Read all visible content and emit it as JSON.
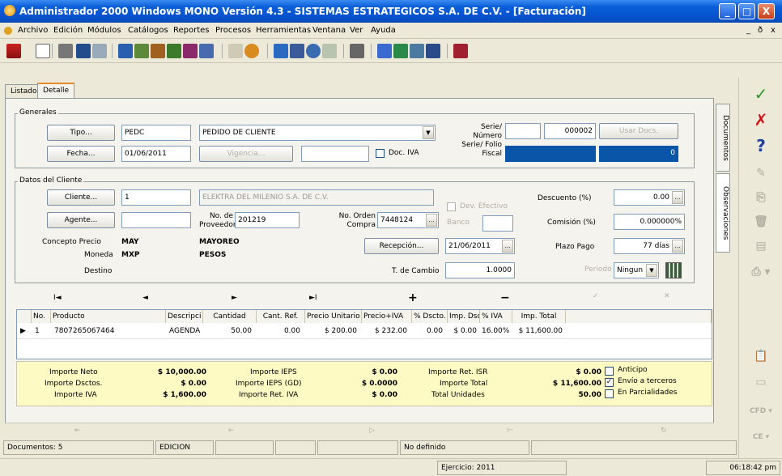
{
  "window": {
    "title": "Administrador 2000 Windows MONO Versión 4.3 - SISTEMAS ESTRATEGICOS S.A. DE C.V. - [Facturación]",
    "min": "_",
    "max": "□",
    "close": "X"
  },
  "menu": [
    "Archivo",
    "Edición",
    "Módulos",
    "Catálogos",
    "Reportes",
    "Procesos",
    "Herramientas",
    "Ventana",
    "Ver",
    "Ayuda"
  ],
  "mdi_controls": [
    "_",
    "ð",
    "x"
  ],
  "tabs": {
    "listado": "Listado",
    "detalle": "Detalle"
  },
  "generales": {
    "section": "Generales",
    "tipo_btn": "Tipo...",
    "tipo_code": "PEDC",
    "tipo_desc": "PEDIDO DE CLIENTE",
    "fecha_btn": "Fecha...",
    "fecha": "01/06/2011",
    "vigencia_btn": "Vigencia...",
    "doc_iva": "Doc. IVA",
    "serie_numero_label": "Serie/\nNúmero",
    "serie": "",
    "numero": "000002",
    "usar_docs": "Usar Docs.",
    "serie_folio_label": "Serie/ Folio\nFiscal",
    "folio_fiscal": "0"
  },
  "cliente": {
    "section": "Datos del Cliente",
    "cliente_btn": "Cliente...",
    "cliente_code": "1",
    "cliente_nombre": "ELEKTRA DEL MILENIO S.A. DE C.V.",
    "agente_btn": "Agente...",
    "no_proveedor_label": "No. de\nProveedor",
    "no_proveedor": "201219",
    "no_orden_label": "No. Orden\nCompra",
    "no_orden": "7448124",
    "dev_efectivo": "Dev. Efectivo",
    "banco": "Banco",
    "recepcion_btn": "Recepción...",
    "recepcion_fecha": "21/06/2011",
    "t_cambio_label": "T. de Cambio",
    "t_cambio": "1.0000",
    "concepto_precio_label": "Concepto Precio",
    "concepto_precio": "MAY",
    "concepto_precio_desc": "MAYOREO",
    "moneda_label": "Moneda",
    "moneda": "MXP",
    "moneda_desc": "PESOS",
    "destino_label": "Destino",
    "descuento_label": "Descuento (%)",
    "descuento": "0.00",
    "comision_label": "Comisión (%)",
    "comision": "0.000000%",
    "plazo_label": "Plazo Pago",
    "plazo": "77 días",
    "periodo_label": "Periodo",
    "periodo": "Ningun"
  },
  "side_tabs": {
    "documentos": "Documentos",
    "observaciones": "Observaciones"
  },
  "nav": {
    "first": "I◄",
    "prev": "◄",
    "next": "►",
    "last": "►I",
    "add": "+",
    "remove": "−"
  },
  "grid": {
    "columns": [
      "No.",
      "Producto",
      "Descripci",
      "Cantidad",
      "Cant. Ref.",
      "Precio Unitario",
      "Precio+IVA",
      "% Dscto.",
      "Imp. Dscl",
      "% IVA",
      "Imp. Total"
    ],
    "rows": [
      [
        "1",
        "7807265067464",
        "AGENDA ,",
        "50.00",
        "0.00",
        "$ 200.00",
        "$ 232.00",
        "0.00",
        "$ 0.00",
        "16.00%",
        "$ 11,600.00"
      ]
    ]
  },
  "totals": {
    "importe_neto_label": "Importe Neto",
    "importe_neto": "$ 10,000.00",
    "importe_dsctos_label": "Importe Dsctos.",
    "importe_dsctos": "$ 0.00",
    "importe_iva_label": "Importe IVA",
    "importe_iva": "$ 1,600.00",
    "importe_ieps_label": "Importe IEPS",
    "importe_ieps": "$ 0.00",
    "importe_ieps_gd_label": "Importe IEPS (GD)",
    "importe_ieps_gd": "$ 0.0000",
    "importe_ret_iva_label": "Importe Ret. IVA",
    "importe_ret_iva": "$ 0.00",
    "importe_ret_isr_label": "Importe Ret. ISR",
    "importe_ret_isr": "$ 0.00",
    "importe_total_label": "Importe Total",
    "importe_total": "$ 11,600.00",
    "total_unidades_label": "Total Unidades",
    "total_unidades": "50.00",
    "anticipo": "Anticipo",
    "envio_terceros": "Envío a terceros",
    "parcialidades": "En Parcialidades"
  },
  "right_toolbar": {
    "cfd": "CFD",
    "ce": "CE"
  },
  "status": {
    "documentos": "Documentos: 5",
    "modo": "EDICION",
    "definido": "No definido",
    "ejercicio": "Ejercicio: 2011",
    "hora": "06:18:42 pm"
  },
  "colors": {
    "title_bar": "#0553d0",
    "totals_bg": "#fdfac4",
    "folio_bg": "#0b55a8",
    "accept": "#2a9a2a",
    "cancel": "#cc1111",
    "help": "#1a3fa0"
  }
}
